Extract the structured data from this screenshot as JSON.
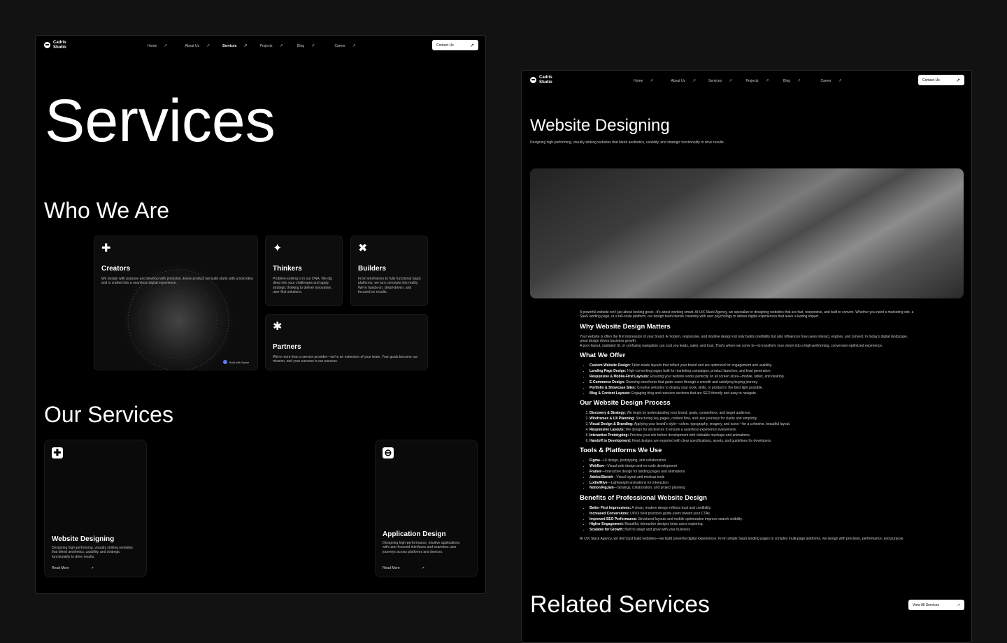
{
  "brand": {
    "line1": "Cadris",
    "line2": "Studio"
  },
  "nav": {
    "items": [
      {
        "label": "Home"
      },
      {
        "label": "About Us"
      },
      {
        "label": "Services"
      },
      {
        "label": "Projects"
      },
      {
        "label": "Blog"
      },
      {
        "label": "Career"
      }
    ],
    "contact_label": "Contact Us",
    "arrow": "↗"
  },
  "page1": {
    "hero_title": "Services",
    "who_title": "Who We Are",
    "cards": {
      "creators": {
        "title": "Creators",
        "text": "We design with purpose and develop with precision. Every product we build starts with a bold idea and is crafted into a seamless digital experience.",
        "badge": "Built with Spline"
      },
      "thinkers": {
        "title": "Thinkers",
        "text": "Problem-solving is in our DNA. We dig deep into your challenges and apply strategic thinking to deliver innovative, user-first solutions."
      },
      "builders": {
        "title": "Builders",
        "text": "From wireframes to fully functional SaaS platforms, we turn concepts into reality. We're hands-on, detail-driven, and focused on results."
      },
      "partners": {
        "title": "Partners",
        "text": "We're more than a service provider—we're an extension of your team. Your goals become our mission, and your success is our success."
      }
    },
    "our_services_title": "Our Services",
    "services": [
      {
        "title": "Website Designing",
        "desc": "Designing high-performing, visually striking websites that blend aesthetics, usability, and strategic functionality to drive results.",
        "read_more": "Read More"
      },
      {
        "title": "Application Design",
        "desc": "Designing high-performance, intuitive applications with user-focused interfaces and seamless user journeys across platforms and devices.",
        "read_more": "Read More"
      }
    ]
  },
  "page2": {
    "title": "Website Designing",
    "subtitle": "Designing high-performing, visually striking websites that blend aesthetics, usability, and strategic functionality to drive results.",
    "intro": "A powerful website isn't just about looking good—it's about working smart. At UIX Stack Agency, we specialize in designing websites that are fast, responsive, and built to convert. Whether you need a marketing site, a SaaS landing page, or a full-scale platform, our design team blends creativity with user psychology to deliver digital experiences that leave a lasting impact.",
    "why_title": "Why Website Design Matters",
    "why_text": "Your website is often the first impression of your brand. A modern, responsive, and intuitive design not only builds credibility but also influences how users interact, explore, and convert. In today's digital landscape, great design drives business growth.",
    "why_text2": "A poor layout, outdated UI, or confusing navigation can cost you leads, sales, and trust. That's where we come in—to transform your vision into a high-performing, conversion-optimized experience.",
    "offer_title": "What We Offer",
    "offer": [
      {
        "b": "Custom Website Design:",
        "t": " Tailor-made layouts that reflect your brand and are optimized for engagement and usability."
      },
      {
        "b": "Landing Page Design:",
        "t": " High-converting pages built for marketing campaigns, product launches, and lead generation."
      },
      {
        "b": "Responsive & Mobile-First Layouts:",
        "t": " Ensuring your website works perfectly on all screen sizes—mobile, tablet, and desktop."
      },
      {
        "b": "E-Commerce Design:",
        "t": " Stunning storefronts that guide users through a smooth and satisfying buying journey."
      },
      {
        "b": "Portfolio & Showcase Sites:",
        "t": " Creative websites to display your work, skills, or product in the best light possible."
      },
      {
        "b": "Blog & Content Layouts:",
        "t": " Engaging blog and resource sections that are SEO-friendly and easy to navigate."
      }
    ],
    "process_title": "Our Website Design Process",
    "process": [
      {
        "b": "Discovery & Strategy:",
        "t": " We begin by understanding your brand, goals, competitors, and target audience."
      },
      {
        "b": "Wireframes & UX Planning:",
        "t": " Structuring key pages, content flow, and user journeys for clarity and simplicity."
      },
      {
        "b": "Visual Design & Branding:",
        "t": " Applying your brand's style—colors, typography, imagery, and icons—for a cohesive, beautiful layout."
      },
      {
        "b": "Responsive Layouts:",
        "t": " We design for all devices to ensure a seamless experience everywhere."
      },
      {
        "b": "Interactive Prototyping:",
        "t": " Preview your site before development with clickable mockups and animations."
      },
      {
        "b": "Handoff to Development:",
        "t": " Final designs are exported with clear specifications, assets, and guidelines for developers."
      }
    ],
    "tools_title": "Tools & Platforms We Use",
    "tools": [
      {
        "b": "Figma",
        "t": "—UI design, prototyping, and collaboration"
      },
      {
        "b": "Webflow",
        "t": "—Visual web design and no-code development"
      },
      {
        "b": "Framer",
        "t": "—Interactive design for landing pages and animations"
      },
      {
        "b": "Adobe/Sketch",
        "t": "—Visual layout and mockup tools"
      },
      {
        "b": "Lottie/Rive",
        "t": "—Lightweight animations for interaction"
      },
      {
        "b": "Notion/FigJam",
        "t": "—Strategy, collaboration, and project planning"
      }
    ],
    "benefits_title": "Benefits of Professional Website Design",
    "benefits": [
      {
        "b": "Better First Impressions:",
        "t": " A clean, modern design reflects trust and credibility."
      },
      {
        "b": "Increased Conversions:",
        "t": " UI/UX best practices guide users toward your CTAs."
      },
      {
        "b": "Improved SEO Performance:",
        "t": " Structured layouts and mobile optimization improve search visibility."
      },
      {
        "b": "Higher Engagement:",
        "t": " Beautiful, interactive designs keep users exploring."
      },
      {
        "b": "Scalable for Growth:",
        "t": " Built to adapt and grow with your business"
      }
    ],
    "outro": "At UIX Stack Agency, we don't just build websites—we build powerful digital experiences. From simple SaaS landing pages to complex multi-page platforms, we design with precision, performance, and purpose.",
    "related_title": "Related Services",
    "view_all": "View All Services"
  }
}
